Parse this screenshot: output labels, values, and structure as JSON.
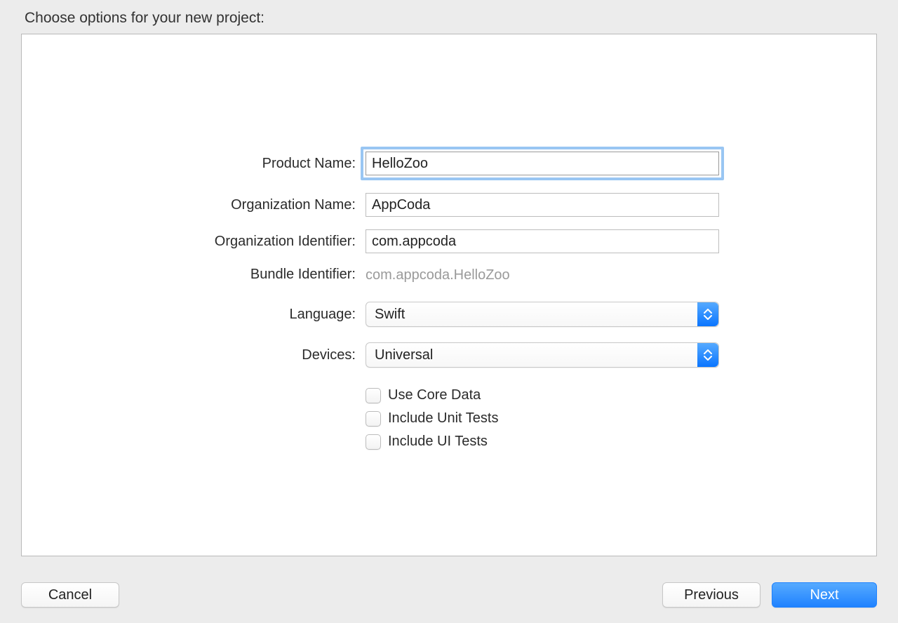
{
  "title": "Choose options for your new project:",
  "form": {
    "productName": {
      "label": "Product Name:",
      "value": "HelloZoo"
    },
    "orgName": {
      "label": "Organization Name:",
      "value": "AppCoda"
    },
    "orgIdent": {
      "label": "Organization Identifier:",
      "value": "com.appcoda"
    },
    "bundleIdent": {
      "label": "Bundle Identifier:",
      "value": "com.appcoda.HelloZoo"
    },
    "language": {
      "label": "Language:",
      "value": "Swift"
    },
    "devices": {
      "label": "Devices:",
      "value": "Universal"
    },
    "useCoreData": {
      "label": "Use Core Data",
      "checked": false
    },
    "includeUnitTests": {
      "label": "Include Unit Tests",
      "checked": false
    },
    "includeUITests": {
      "label": "Include UI Tests",
      "checked": false
    }
  },
  "buttons": {
    "cancel": "Cancel",
    "previous": "Previous",
    "next": "Next"
  }
}
